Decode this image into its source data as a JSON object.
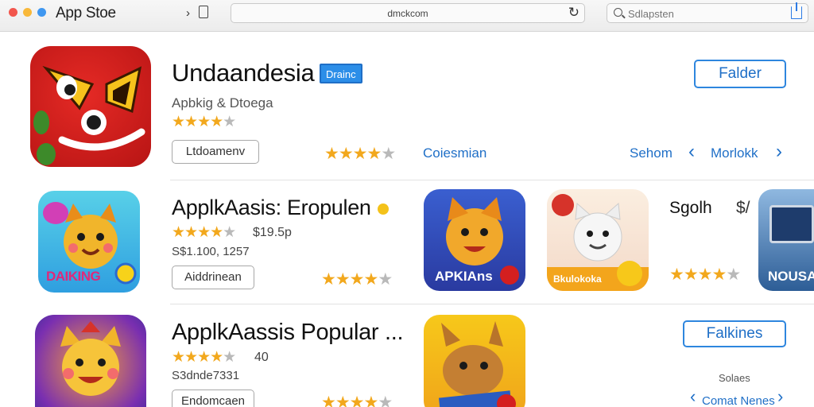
{
  "window": {
    "app_title": "App Stoe",
    "address": "dmckcom",
    "search_placeholder": "Sdlapsten",
    "reload_glyph": "↻",
    "nav_glyph": "›"
  },
  "featured": {
    "title": "Undaandesia",
    "badge": "Drainc",
    "subtitle": "Apbkig & Dtoega",
    "rating_stars": 4.5,
    "secondary_rating_stars": 4,
    "button_label": "Ltdoamenv",
    "link_label": "Coiesmian",
    "action_label": "Falder",
    "nav_left_label": "Sehom",
    "nav_right_label": "Morlokk"
  },
  "row2": {
    "title": "ApplkAasis: Eropulen",
    "rating_stars": 4.5,
    "price": "$19.5p",
    "size_text": "S$1.100, 1257",
    "button_label": "Aiddrinean",
    "secondary_rating_stars": 4,
    "icon_caption": "DAIKING",
    "card1_caption": "APKIAns",
    "card2_caption": "Bkulokoka",
    "card2_rating_stars": 4,
    "label": "Sgolh",
    "price_label": "$/",
    "card3_caption": "NOUSA"
  },
  "row3": {
    "title": "ApplkAassis Popular ...",
    "rating_stars": 4.5,
    "rating_count": "40",
    "size_text": "S3dnde7331",
    "button_label": "Endomcaen",
    "secondary_rating_stars": 4.5,
    "action_label": "Falkines",
    "small_label": "Solaes",
    "nav_label": "Comat Nenes"
  },
  "colors": {
    "accent_blue": "#2e86de",
    "star_gold": "#f2a81d",
    "badge_blue": "#2c8ee8"
  }
}
